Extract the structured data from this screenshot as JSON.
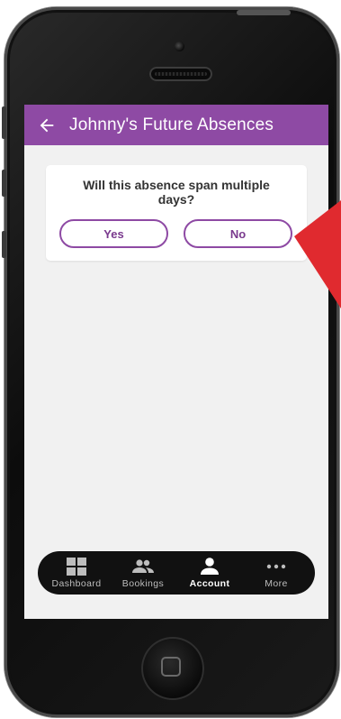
{
  "header": {
    "back_icon": "arrow-left-icon",
    "title": "Johnny's Future Absences"
  },
  "prompt_card": {
    "question": "Will this absence span multiple days?",
    "yes_label": "Yes",
    "no_label": "No"
  },
  "bottom_nav": {
    "items": [
      {
        "label": "Dashboard",
        "icon": "dashboard-grid-icon"
      },
      {
        "label": "Bookings",
        "icon": "people-icon"
      },
      {
        "label": "Account",
        "icon": "person-icon",
        "active": true
      },
      {
        "label": "More",
        "icon": "more-dots-icon"
      }
    ]
  },
  "colors": {
    "accent": "#8e4aa4",
    "screen_bg": "#f1f1f1",
    "nav_bg": "#111111",
    "pointer": "#e02a2f"
  }
}
